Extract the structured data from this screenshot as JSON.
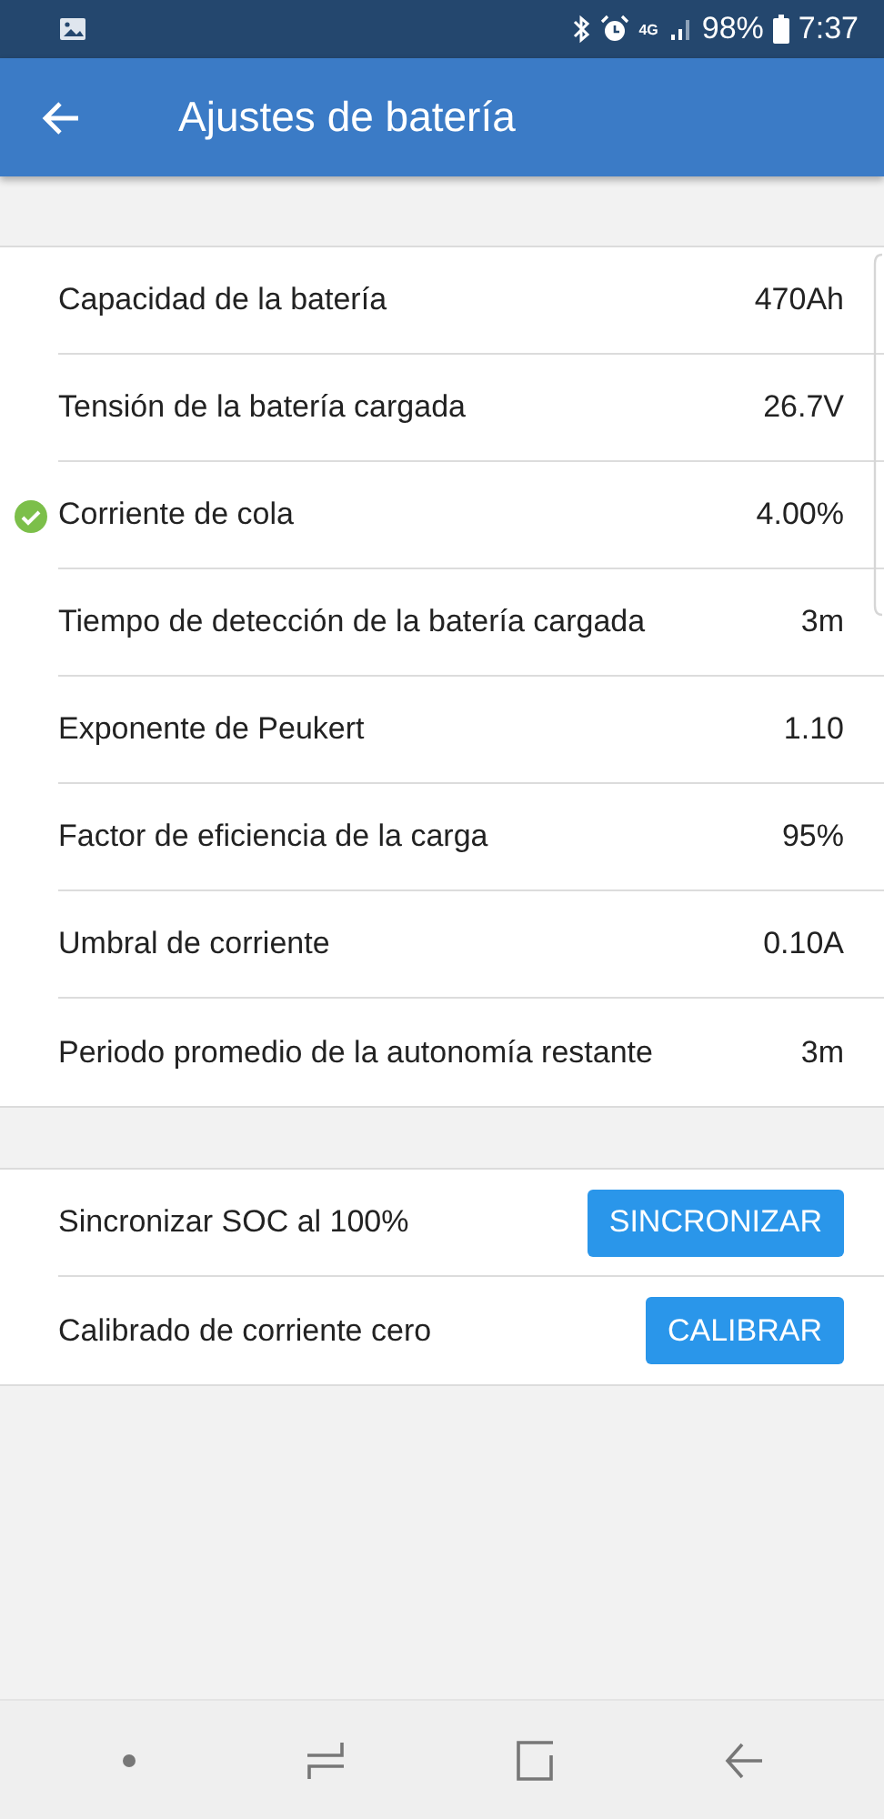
{
  "status_bar": {
    "battery": "98%",
    "network": "4G",
    "time": "7:37"
  },
  "app_bar": {
    "title": "Ajustes de batería"
  },
  "settings": [
    {
      "label": "Capacidad de la batería",
      "value": "470Ah",
      "verified": false
    },
    {
      "label": "Tensión de la batería cargada",
      "value": "26.7V",
      "verified": false
    },
    {
      "label": "Corriente de cola",
      "value": "4.00%",
      "verified": true
    },
    {
      "label": "Tiempo de detección de la batería cargada",
      "value": "3m",
      "verified": false
    },
    {
      "label": "Exponente de Peukert",
      "value": "1.10",
      "verified": false
    },
    {
      "label": "Factor de eficiencia de la carga",
      "value": "95%",
      "verified": false
    },
    {
      "label": "Umbral de corriente",
      "value": "0.10A",
      "verified": false
    },
    {
      "label": "Periodo promedio de la autonomía restante",
      "value": "3m",
      "verified": false
    }
  ],
  "actions": [
    {
      "label": "Sincronizar SOC al 100%",
      "button": "SINCRONIZAR"
    },
    {
      "label": "Calibrado de corriente cero",
      "button": "CALIBRAR"
    }
  ]
}
